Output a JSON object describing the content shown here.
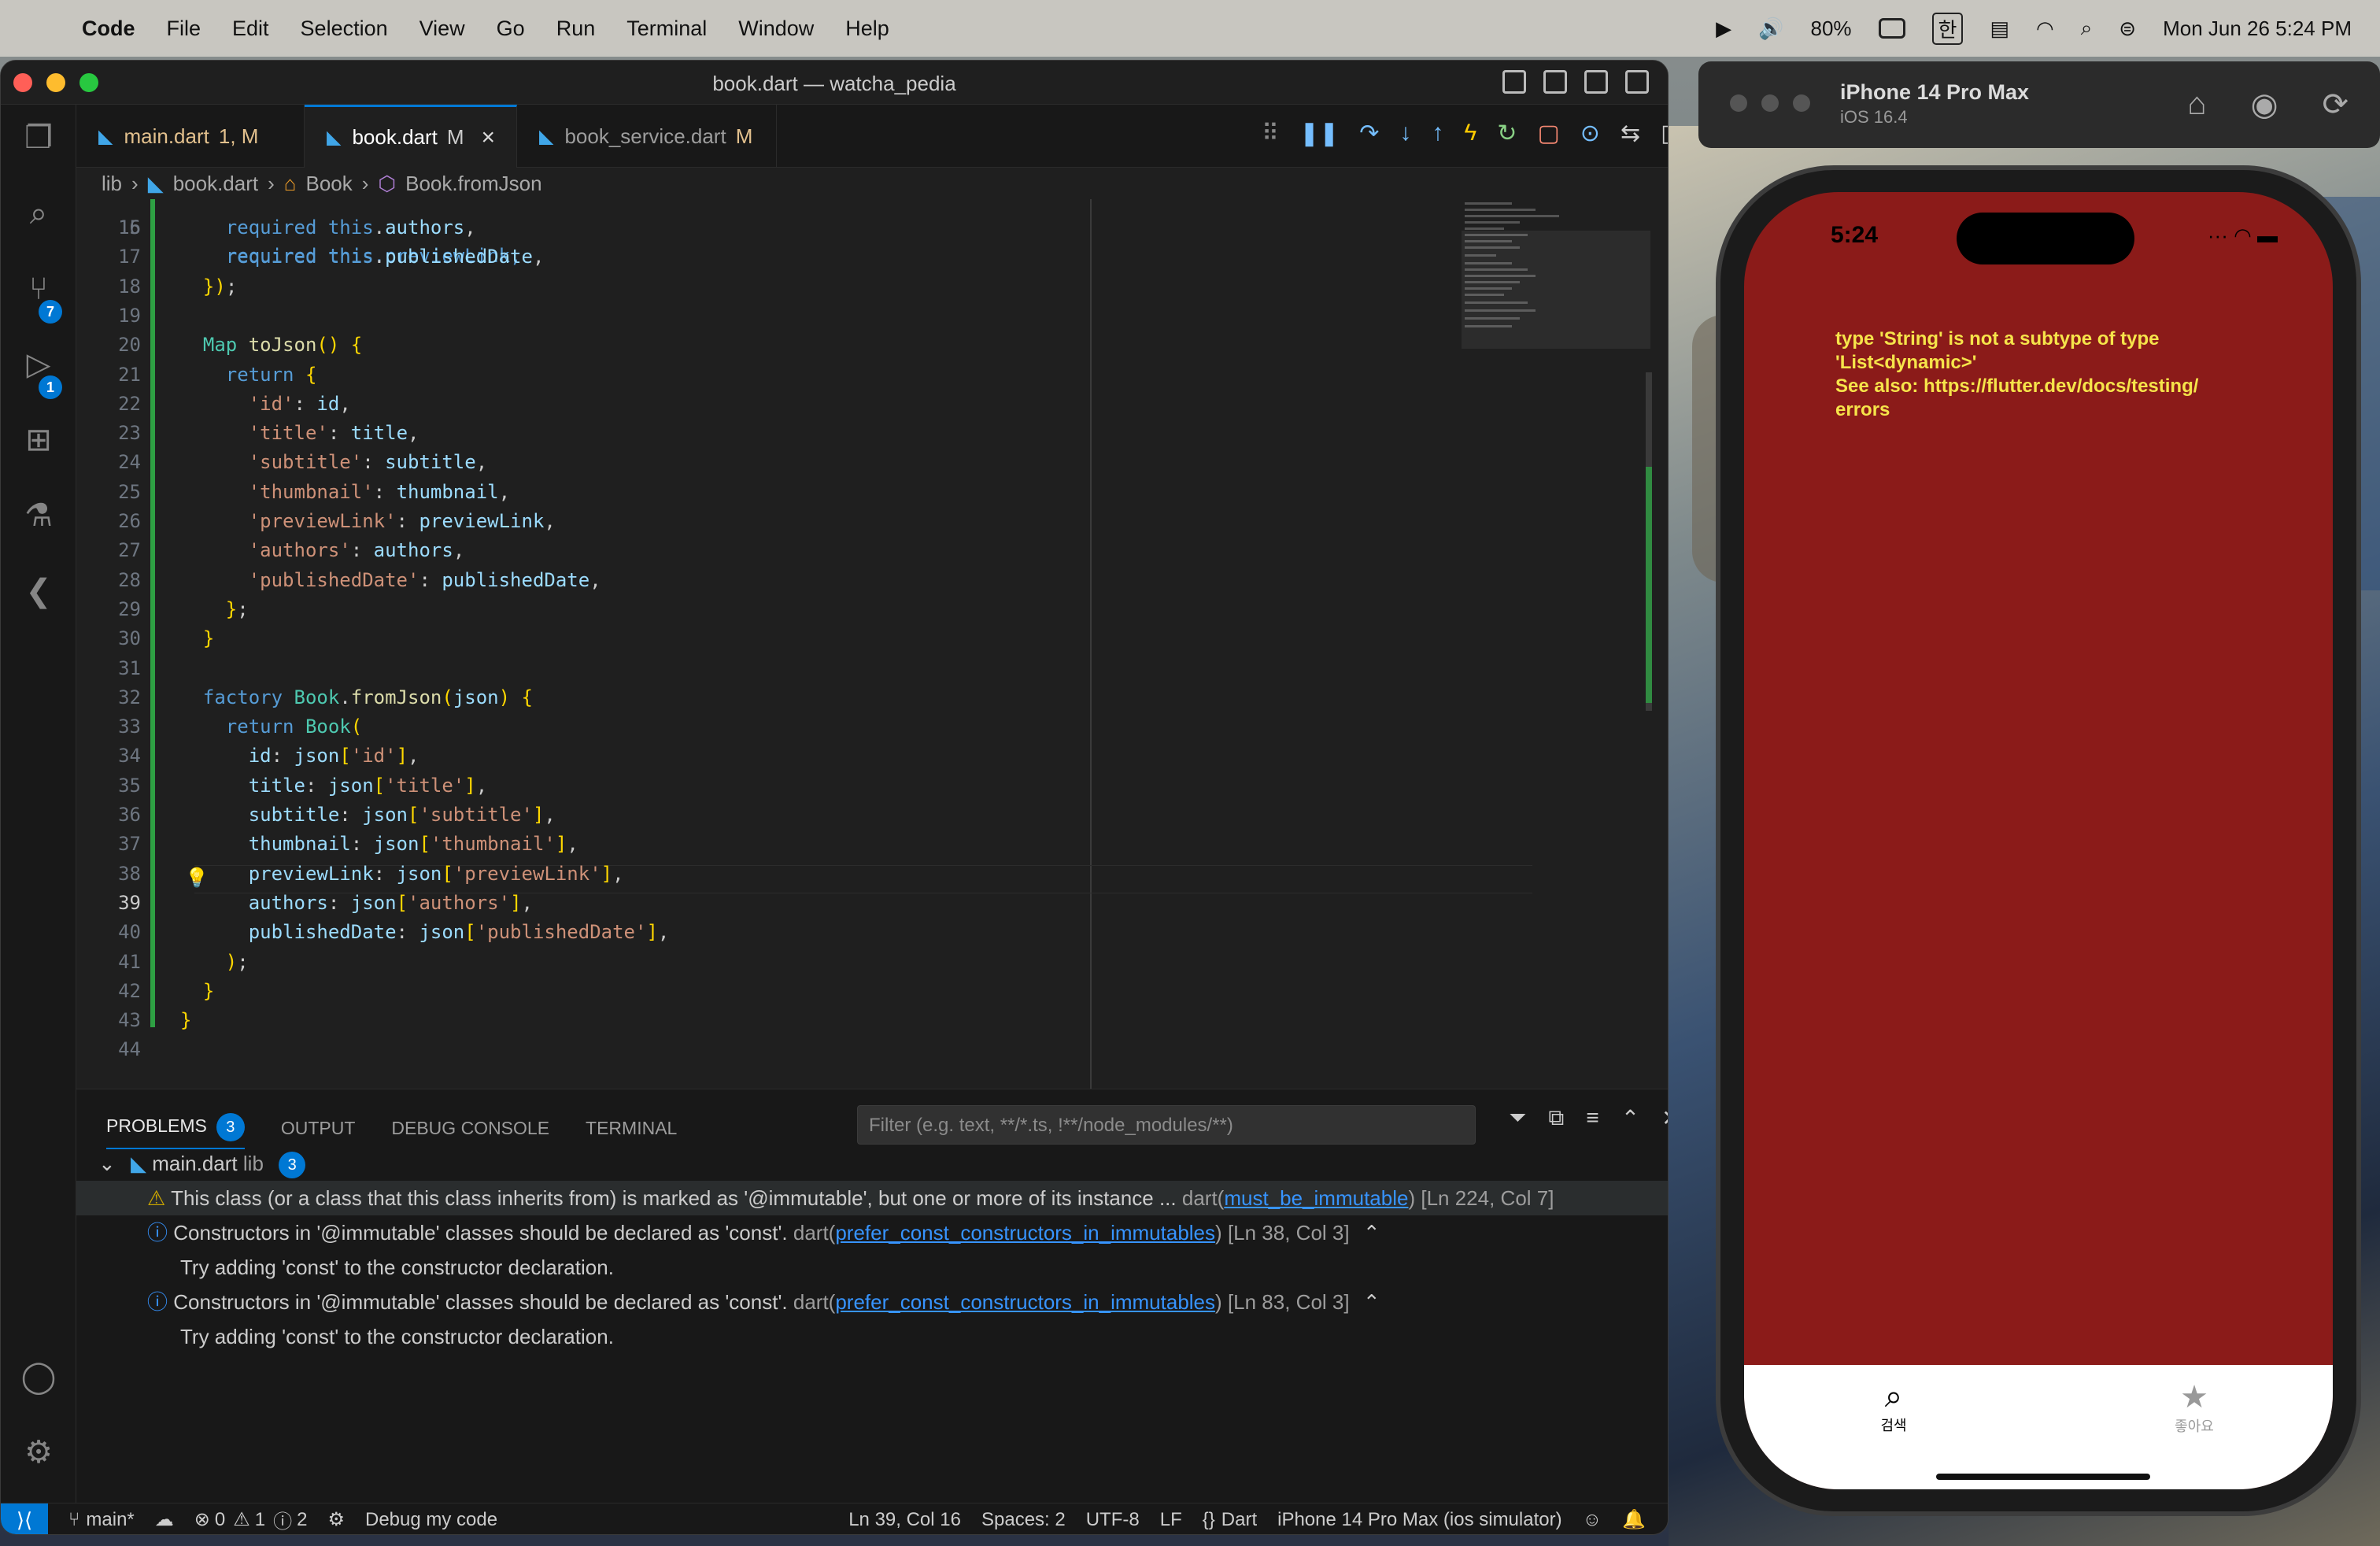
{
  "menubar": {
    "app": "Code",
    "items": [
      "File",
      "Edit",
      "Selection",
      "View",
      "Go",
      "Run",
      "Terminal",
      "Window",
      "Help"
    ],
    "battery": "80%",
    "input_lang": "한",
    "datetime": "Mon Jun 26  5:24 PM"
  },
  "window": {
    "title": "book.dart — watcha_pedia"
  },
  "activity": {
    "scm_badge": "7",
    "debug_badge": "1"
  },
  "tabs": [
    {
      "label": "main.dart",
      "status": "1, M"
    },
    {
      "label": "book.dart",
      "status": "M"
    },
    {
      "label": "book_service.dart",
      "status": "M"
    }
  ],
  "breadcrumb": {
    "p1": "lib",
    "p2": "book.dart",
    "p3": "Book",
    "p4": "Book.fromJson"
  },
  "editor": {
    "partial_line": "    required this.previewLink,",
    "lines": [
      {
        "n": "16",
        "t": "    required this.authors,"
      },
      {
        "n": "17",
        "t": "    required this.publishedDate,"
      },
      {
        "n": "18",
        "t": "  });"
      },
      {
        "n": "19",
        "t": ""
      },
      {
        "n": "20",
        "t": "  Map toJson() {"
      },
      {
        "n": "21",
        "t": "    return {"
      },
      {
        "n": "22",
        "t": "      'id': id,"
      },
      {
        "n": "23",
        "t": "      'title': title,"
      },
      {
        "n": "24",
        "t": "      'subtitle': subtitle,"
      },
      {
        "n": "25",
        "t": "      'thumbnail': thumbnail,"
      },
      {
        "n": "26",
        "t": "      'previewLink': previewLink,"
      },
      {
        "n": "27",
        "t": "      'authors': authors,"
      },
      {
        "n": "28",
        "t": "      'publishedDate': publishedDate,"
      },
      {
        "n": "29",
        "t": "    };"
      },
      {
        "n": "30",
        "t": "  }"
      },
      {
        "n": "31",
        "t": ""
      },
      {
        "n": "32",
        "t": "  factory Book.fromJson(json) {"
      },
      {
        "n": "33",
        "t": "    return Book("
      },
      {
        "n": "34",
        "t": "      id: json['id'],"
      },
      {
        "n": "35",
        "t": "      title: json['title'],"
      },
      {
        "n": "36",
        "t": "      subtitle: json['subtitle'],"
      },
      {
        "n": "37",
        "t": "      thumbnail: json['thumbnail'],"
      },
      {
        "n": "38",
        "t": "      previewLink: json['previewLink'],"
      },
      {
        "n": "39",
        "t": "      authors: json['authors'],"
      },
      {
        "n": "40",
        "t": "      publishedDate: json['publishedDate'],"
      },
      {
        "n": "41",
        "t": "    );"
      },
      {
        "n": "42",
        "t": "  }"
      },
      {
        "n": "43",
        "t": "}"
      },
      {
        "n": "44",
        "t": ""
      }
    ]
  },
  "panel": {
    "tabs": [
      "PROBLEMS",
      "OUTPUT",
      "DEBUG CONSOLE",
      "TERMINAL"
    ],
    "problems_count": "3",
    "filter_placeholder": "Filter (e.g. text, **/*.ts, !**/node_modules/**)",
    "group": {
      "file": "main.dart",
      "folder": "lib",
      "count": "3"
    },
    "problems": [
      {
        "msg": "This class (or a class that this class inherits from) is marked as '@immutable', but one or more of its instance ...",
        "src": "dart(",
        "code": "must_be_immutable",
        "end": ")",
        "loc": "[Ln 224, Col 7]"
      },
      {
        "msg": "Constructors in '@immutable' classes should be declared as 'const'.",
        "src": "dart(",
        "code": "prefer_const_constructors_in_immutables",
        "end": ")",
        "loc": "[Ln 38, Col 3]",
        "hint": "Try adding 'const' to the constructor declaration."
      },
      {
        "msg": "Constructors in '@immutable' classes should be declared as 'const'.",
        "src": "dart(",
        "code": "prefer_const_constructors_in_immutables",
        "end": ")",
        "loc": "[Ln 83, Col 3]",
        "hint": "Try adding 'const' to the constructor declaration."
      }
    ]
  },
  "status": {
    "branch": "main*",
    "errors": "0",
    "warnings": "1",
    "infos": "2",
    "debug": "Debug my code",
    "position": "Ln 39, Col 16",
    "spaces": "Spaces: 2",
    "encoding": "UTF-8",
    "eol": "LF",
    "language": "Dart",
    "device": "iPhone 14 Pro Max (ios simulator)"
  },
  "simulator": {
    "device": "iPhone 14 Pro Max",
    "os": "iOS 16.4",
    "time": "5:24",
    "error_line1": "type 'String' is not a subtype of type",
    "error_line2": "'List<dynamic>'",
    "error_line3": "See also: https://flutter.dev/docs/testing/",
    "error_line4": "errors",
    "nav_search": "검색",
    "nav_fav": "좋아요",
    "error_bg": "#8b1b19",
    "error_text_color": "#f6e44a"
  }
}
